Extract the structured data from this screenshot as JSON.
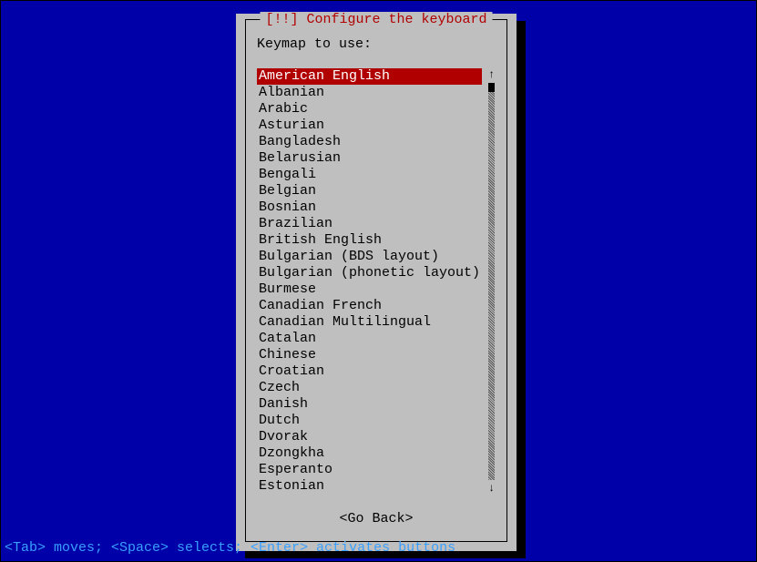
{
  "dialog": {
    "title": "[!!] Configure the keyboard",
    "prompt": "Keymap to use:",
    "go_back": "<Go Back>",
    "selected_index": 0,
    "items": [
      "American English",
      "Albanian",
      "Arabic",
      "Asturian",
      "Bangladesh",
      "Belarusian",
      "Bengali",
      "Belgian",
      "Bosnian",
      "Brazilian",
      "British English",
      "Bulgarian (BDS layout)",
      "Bulgarian (phonetic layout)",
      "Burmese",
      "Canadian French",
      "Canadian Multilingual",
      "Catalan",
      "Chinese",
      "Croatian",
      "Czech",
      "Danish",
      "Dutch",
      "Dvorak",
      "Dzongkha",
      "Esperanto",
      "Estonian"
    ]
  },
  "helpbar": "<Tab> moves; <Space> selects; <Enter> activates buttons"
}
